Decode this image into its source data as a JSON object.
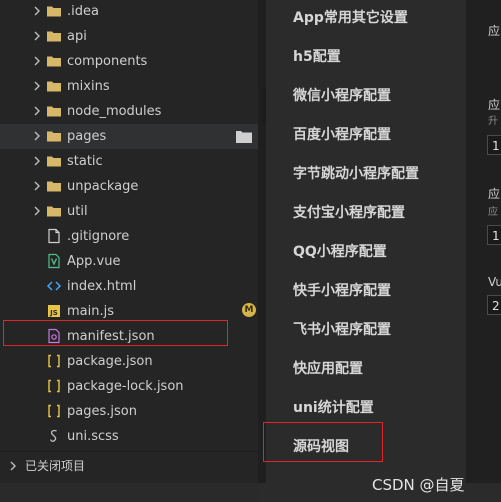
{
  "explorer": {
    "items": [
      {
        "label": ".idea",
        "icon": "folder-icon",
        "type": "folder"
      },
      {
        "label": "api",
        "icon": "folder-icon",
        "type": "folder"
      },
      {
        "label": "components",
        "icon": "folder-icon",
        "type": "folder"
      },
      {
        "label": "mixins",
        "icon": "folder-icon",
        "type": "folder"
      },
      {
        "label": "node_modules",
        "icon": "folder-icon",
        "type": "folder"
      },
      {
        "label": "pages",
        "icon": "folder-icon",
        "type": "folder"
      },
      {
        "label": "static",
        "icon": "folder-icon",
        "type": "folder"
      },
      {
        "label": "unpackage",
        "icon": "folder-icon",
        "type": "folder"
      },
      {
        "label": "util",
        "icon": "folder-icon",
        "type": "folder"
      },
      {
        "label": ".gitignore",
        "icon": "file-icon",
        "type": "file"
      },
      {
        "label": "App.vue",
        "icon": "vue-file-icon",
        "type": "file"
      },
      {
        "label": "index.html",
        "icon": "html-file-icon",
        "type": "file"
      },
      {
        "label": "main.js",
        "icon": "js-file-icon",
        "type": "file",
        "badge": "M"
      },
      {
        "label": "manifest.json",
        "icon": "manifest-file-icon",
        "type": "file"
      },
      {
        "label": "package.json",
        "icon": "json-file-icon",
        "type": "file"
      },
      {
        "label": "package-lock.json",
        "icon": "json-file-icon",
        "type": "file"
      },
      {
        "label": "pages.json",
        "icon": "json-file-icon",
        "type": "file"
      },
      {
        "label": "uni.scss",
        "icon": "scss-file-icon",
        "type": "file"
      }
    ],
    "closed_projects_label": "已关闭项目"
  },
  "config_menu": {
    "items": [
      "App常用其它设置",
      "h5配置",
      "微信小程序配置",
      "百度小程序配置",
      "字节跳动小程序配置",
      "支付宝小程序配置",
      "QQ小程序配置",
      "快手小程序配置",
      "飞书小程序配置",
      "快应用配置",
      "uni统计配置",
      "源码视图"
    ]
  },
  "right_panel": {
    "fragments": [
      "应",
      "应",
      "升",
      "1",
      "应",
      "应",
      "1",
      "Vu",
      "2"
    ]
  },
  "watermark": "CSDN @自夏",
  "colors": {
    "folder": "#d7b768",
    "vue": "#4fc08d",
    "html": "#42a5f5",
    "js": "#e8c547",
    "manifest": "#c678dd",
    "json": "#e8c547",
    "highlight": "#e0262b",
    "badge": "#d7b34b"
  }
}
